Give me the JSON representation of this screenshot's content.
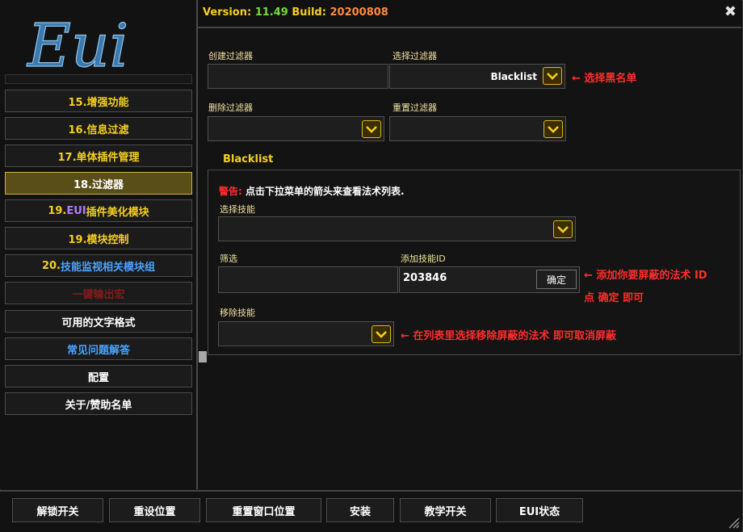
{
  "header": {
    "version_key": "Version:",
    "version_value": "11.49",
    "build_key": "Build:",
    "build_value": "20200808",
    "close_icon": "close-icon"
  },
  "logo": {
    "text": "Eui"
  },
  "sidebar": {
    "items": [
      {
        "label": "15.增强功能"
      },
      {
        "label": "16.信息过滤"
      },
      {
        "label": "17.单体插件管理"
      },
      {
        "label": "18.过滤器"
      },
      {
        "num": "19.",
        "eui": "EUI",
        "rest": "插件美化模块"
      },
      {
        "label": "19.模块控制"
      },
      {
        "num": "20.",
        "rest": "技能监视相关模块组"
      },
      {
        "label": "一键输出宏"
      },
      {
        "label": "可用的文字格式"
      },
      {
        "label": "常见问题解答"
      },
      {
        "label": "配置"
      },
      {
        "label": "关于/赞助名单"
      }
    ]
  },
  "filters": {
    "create_label": "创建过滤器",
    "select_label": "选择过滤器",
    "select_value": "Blacklist",
    "select_note": "← 选择黑名单",
    "delete_label": "删除过滤器",
    "reset_label": "重置过滤器"
  },
  "blacklist": {
    "title": "Blacklist",
    "warn_prefix": "警告:",
    "warn_text": " 点击下拉菜单的箭头来查看法术列表.",
    "skill_label": "选择技能",
    "filter_label": "筛选",
    "add_label": "添加技能ID",
    "add_value": "203846",
    "confirm": "确定",
    "add_note_1": "← 添加你要屏蔽的法术 ID",
    "add_note_2": "点 确定 即可",
    "remove_label": "移除技能",
    "remove_note": "← 在列表里选择移除屏蔽的法术 即可取消屏蔽"
  },
  "bottom": {
    "buttons": [
      "解锁开关",
      "重设位置",
      "重置窗口位置",
      "安装",
      "教学开关",
      "EUI状态"
    ]
  },
  "colors": {
    "accent": "#f5d020",
    "note_red": "#ff2d2d",
    "active_bg": "#5a4e18"
  }
}
